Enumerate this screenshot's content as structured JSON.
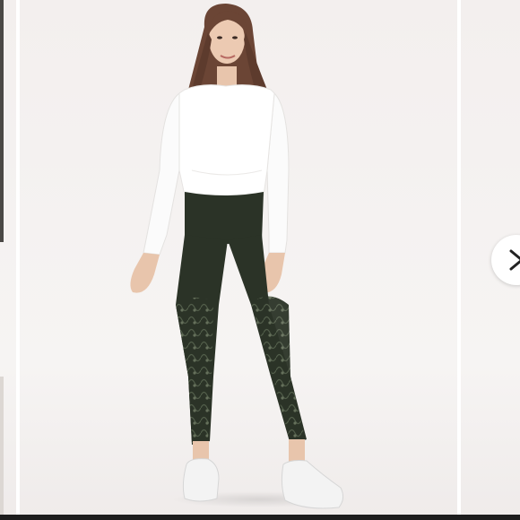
{
  "gallery": {
    "image_alt": "",
    "next_icon": "chevron-right-icon",
    "colors": {
      "background": "#f4f2f1",
      "legging": "#2b3327",
      "top": "#ffffff",
      "sneaker": "#f3f3f3",
      "hair": "#6b4535",
      "skin": "#e8c5ac"
    }
  }
}
